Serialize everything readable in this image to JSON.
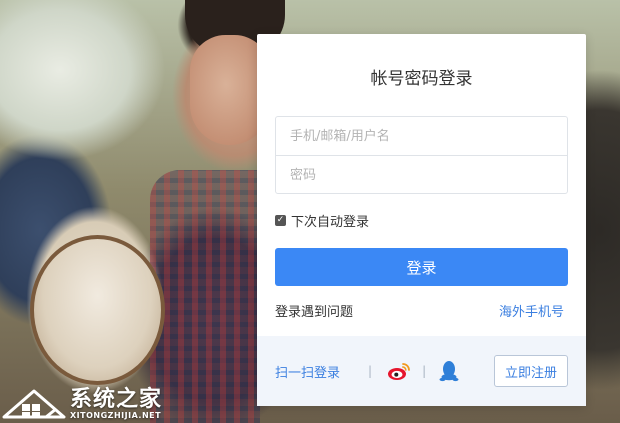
{
  "login_card": {
    "title": "帐号密码登录",
    "account_placeholder": "手机/邮箱/用户名",
    "password_placeholder": "密码",
    "remember_label": "下次自动登录",
    "remember_checked": true,
    "login_button": "登录",
    "trouble_link": "登录遇到问题",
    "overseas_link": "海外手机号"
  },
  "footer": {
    "scan_login": "扫一扫登录",
    "separator": "|",
    "weibo_icon": "weibo-icon",
    "qq_icon": "qq-icon",
    "register_button": "立即注册"
  },
  "watermark": {
    "title": "系统之家",
    "subtitle": "XITONGZHIJIA.NET"
  },
  "colors": {
    "primary": "#3b88f5",
    "link": "#3b7fe0",
    "footer_bg": "#f1f5fb",
    "weibo_red": "#e6162d",
    "qq_blue": "#2f7fd8"
  }
}
